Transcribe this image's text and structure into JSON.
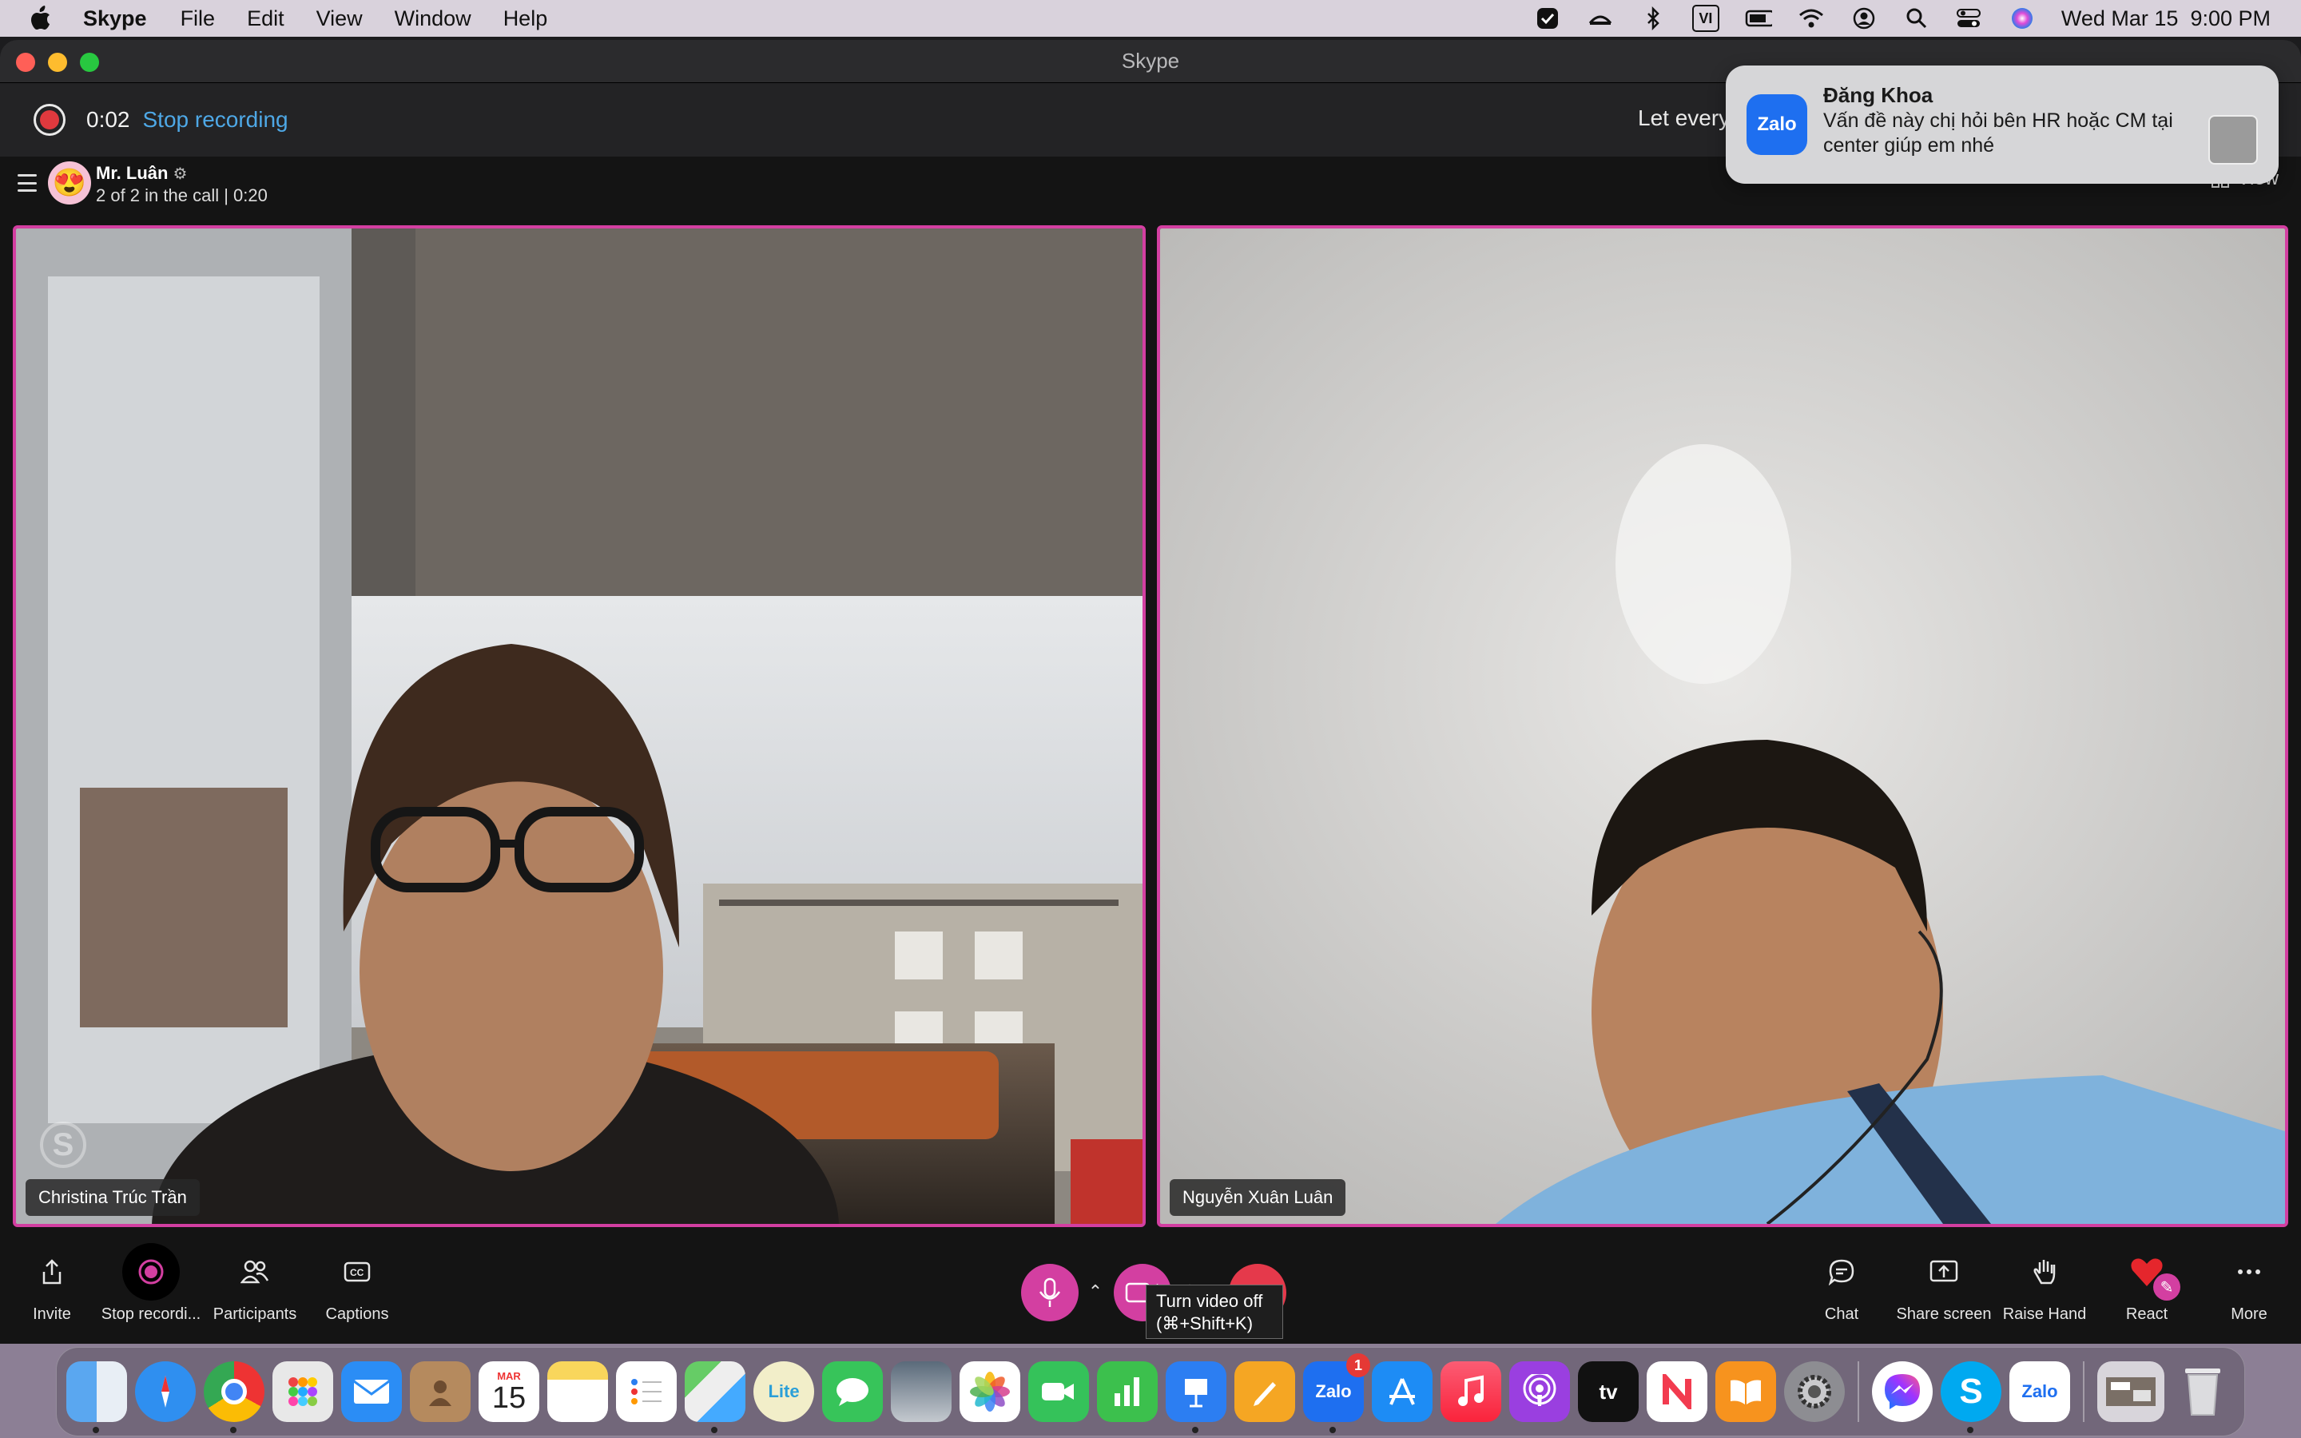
{
  "menubar": {
    "app_name": "Skype",
    "items": [
      "File",
      "Edit",
      "View",
      "Window",
      "Help"
    ],
    "input_source": "VI",
    "datetime": "Wed Mar 15  9:00 PM"
  },
  "window": {
    "title": "Skype"
  },
  "recording": {
    "elapsed": "0:02",
    "stop_label": "Stop recording",
    "message": "Let every"
  },
  "call": {
    "name": "Mr. Luân",
    "status": "2 of 2 in the call | 0:20",
    "view_label": "View"
  },
  "participants": [
    {
      "name": "Christina Trúc Trần"
    },
    {
      "name": "Nguyễn Xuân Luân"
    }
  ],
  "controls": {
    "invite": "Invite",
    "stop_recording": "Stop recordi...",
    "participants": "Participants",
    "captions": "Captions",
    "chat": "Chat",
    "share_screen": "Share screen",
    "raise_hand": "Raise Hand",
    "react": "React",
    "more": "More"
  },
  "tooltip": {
    "line1": "Turn video off",
    "line2": "(⌘+Shift+K)"
  },
  "notification": {
    "app": "Zalo",
    "sender": "Đăng Khoa",
    "body": "Vấn đề này chị hỏi bên HR hoặc CM tại center giúp em nhé"
  },
  "dock": {
    "calendar_month": "MAR",
    "calendar_day": "15",
    "zalo_badge": "1",
    "lite_label": "Lite",
    "tv_label": "tv",
    "zalo_label": "Zalo"
  },
  "colors": {
    "accent_pink": "#d33fa1",
    "record_red": "#e0393e",
    "link_blue": "#4ea8e6",
    "end_call_red": "#e5394b"
  }
}
